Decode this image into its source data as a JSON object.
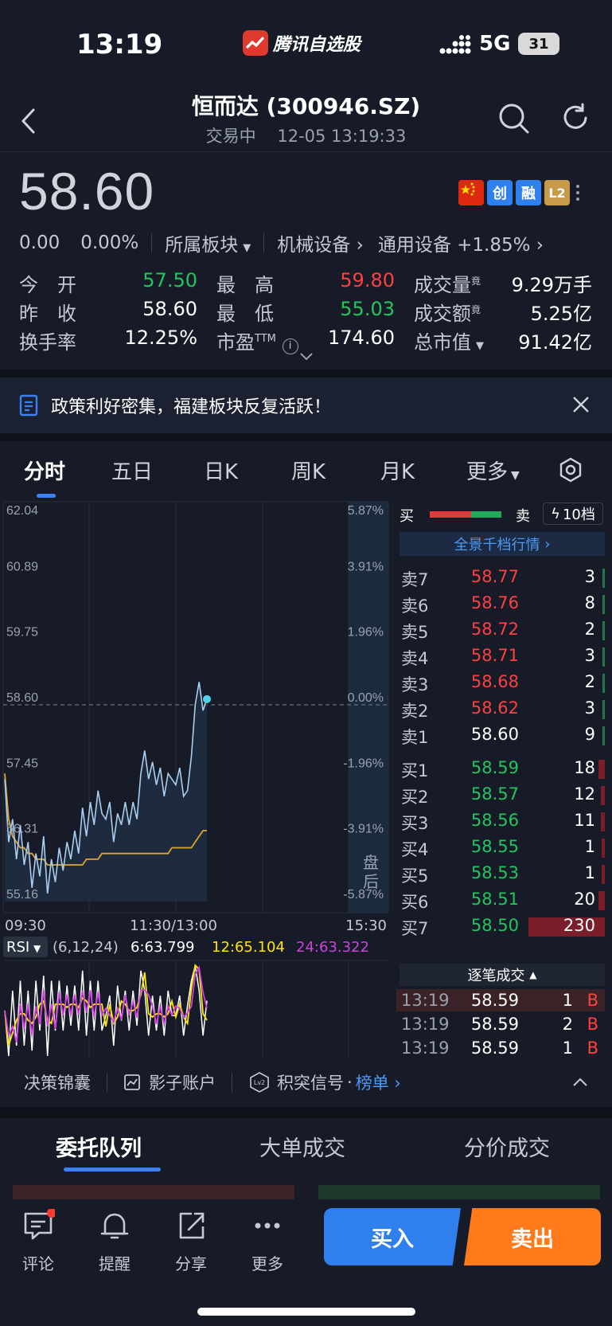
{
  "status": {
    "time": "13:19",
    "app_name": "腾讯自选股",
    "network": "5G",
    "battery": "31"
  },
  "header": {
    "title": "恒而达 (300946.SZ)",
    "status": "交易中",
    "datetime": "12-05 13:19:33"
  },
  "quote": {
    "price": "58.60",
    "change": "0.00",
    "change_pct": "0.00%",
    "sector_label": "所属板块",
    "sector1": "机械设备",
    "sector2": "通用设备 +1.85%",
    "badges": [
      "创",
      "融",
      "L2"
    ],
    "stats": [
      {
        "label": "今　开",
        "value": "57.50",
        "color": "green"
      },
      {
        "label": "最　高",
        "value": "59.80",
        "color": "red"
      },
      {
        "label": "成交量",
        "value": "9.29万手",
        "color": "white"
      },
      {
        "label": "昨　收",
        "value": "58.60",
        "color": "white"
      },
      {
        "label": "最　低",
        "value": "55.03",
        "color": "green"
      },
      {
        "label": "成交额",
        "value": "5.25亿",
        "color": "white"
      },
      {
        "label": "换手率",
        "value": "12.25%",
        "color": "white"
      },
      {
        "label": "市盈",
        "value": "174.60",
        "color": "white"
      },
      {
        "label": "总市值",
        "value": "91.42亿",
        "color": "white"
      }
    ],
    "ttm_sup": "TTM",
    "jing_sup": "竟"
  },
  "notice": {
    "text": "政策利好密集，福建板块反复活跃！"
  },
  "tabs": [
    "分时",
    "五日",
    "日K",
    "周K",
    "月K",
    "更多"
  ],
  "chart_data": {
    "type": "line",
    "title": "",
    "y_prices": [
      "62.04",
      "60.89",
      "59.75",
      "58.60",
      "57.45",
      "56.31",
      "55.16"
    ],
    "y_pcts": [
      "5.87%",
      "3.91%",
      "1.96%",
      "0.00%",
      "-1.96%",
      "-3.91%",
      "-5.87%"
    ],
    "x_labels": [
      "09:30",
      "11:30/13:00",
      "15:30"
    ],
    "ylim": [
      55.16,
      62.04
    ],
    "prev_close": 58.6,
    "after_hours_label": [
      "盘",
      "后"
    ],
    "series": [
      {
        "values": [
          57.3,
          56.2,
          56.6,
          55.9,
          56.5,
          55.8,
          56.2,
          55.4,
          56.0,
          55.6,
          56.3,
          55.3,
          55.9,
          55.5,
          56.1,
          55.7,
          56.2,
          55.9,
          56.4,
          56.0,
          56.8,
          56.3,
          56.9,
          56.5,
          57.1,
          56.7,
          56.6,
          56.9,
          56.2,
          56.7,
          56.5,
          56.9,
          56.5,
          56.9,
          56.6,
          57.4,
          57.8,
          57.3,
          57.6,
          57.2,
          57.5,
          57.0,
          57.4,
          57.3,
          57.2,
          57.5,
          57.0,
          57.1,
          57.7,
          58.6,
          59.0,
          58.5,
          58.7
        ]
      },
      {
        "values": [
          57.4,
          56.6,
          56.3,
          56.2,
          56.1,
          56.1,
          56.0,
          56.0,
          55.9,
          55.9,
          55.9,
          55.8,
          55.8,
          55.8,
          55.8,
          55.8,
          55.8,
          55.8,
          55.8,
          55.8,
          55.8,
          55.9,
          55.9,
          55.9,
          55.9,
          56.0,
          56.0,
          56.0,
          56.0,
          56.0,
          56.0,
          56.0,
          56.0,
          56.0,
          56.0,
          56.0,
          56.0,
          56.0,
          56.0,
          56.0,
          56.0,
          56.0,
          56.0,
          56.1,
          56.1,
          56.1,
          56.1,
          56.1,
          56.1,
          56.2,
          56.3,
          56.4,
          56.4
        ]
      }
    ],
    "rsi": {
      "label": "RSI",
      "params": "(6,12,24)",
      "r6": "6:63.799",
      "r12": "12:65.104",
      "r24": "24:63.322"
    }
  },
  "orderbook": {
    "header_buy": "买",
    "header_sell": "卖",
    "levels_btn": "10档",
    "panorama": "全景千档行情",
    "sells": [
      {
        "label": "卖7",
        "price": "58.77",
        "vol": "3",
        "color": "red"
      },
      {
        "label": "卖6",
        "price": "58.76",
        "vol": "8",
        "color": "red"
      },
      {
        "label": "卖5",
        "price": "58.72",
        "vol": "2",
        "color": "red"
      },
      {
        "label": "卖4",
        "price": "58.71",
        "vol": "3",
        "color": "red"
      },
      {
        "label": "卖3",
        "price": "58.68",
        "vol": "2",
        "color": "red"
      },
      {
        "label": "卖2",
        "price": "58.62",
        "vol": "3",
        "color": "red"
      },
      {
        "label": "卖1",
        "price": "58.60",
        "vol": "9",
        "color": "white"
      }
    ],
    "buys": [
      {
        "label": "买1",
        "price": "58.59",
        "vol": "18"
      },
      {
        "label": "买2",
        "price": "58.57",
        "vol": "12"
      },
      {
        "label": "买3",
        "price": "58.56",
        "vol": "11"
      },
      {
        "label": "买4",
        "price": "58.55",
        "vol": "1"
      },
      {
        "label": "买5",
        "price": "58.53",
        "vol": "1"
      },
      {
        "label": "买6",
        "price": "58.51",
        "vol": "20"
      },
      {
        "label": "买7",
        "price": "58.50",
        "vol": "230"
      }
    ],
    "ticks_title": "逐笔成交",
    "ticks": [
      {
        "time": "13:19",
        "price": "58.59",
        "vol": "1",
        "side": "B"
      },
      {
        "time": "13:19",
        "price": "58.59",
        "vol": "2",
        "side": "B"
      },
      {
        "time": "13:19",
        "price": "58.59",
        "vol": "1",
        "side": "B"
      }
    ]
  },
  "tools": {
    "t1": "决策锦囊",
    "t2": "影子账户",
    "t3": "积突信号",
    "t3_link": "榜单"
  },
  "queue_tabs": [
    "委托队列",
    "大单成交",
    "分价成交"
  ],
  "bottom": {
    "comment": "评论",
    "remind": "提醒",
    "share": "分享",
    "more": "更多",
    "buy": "买入",
    "sell": "卖出"
  }
}
